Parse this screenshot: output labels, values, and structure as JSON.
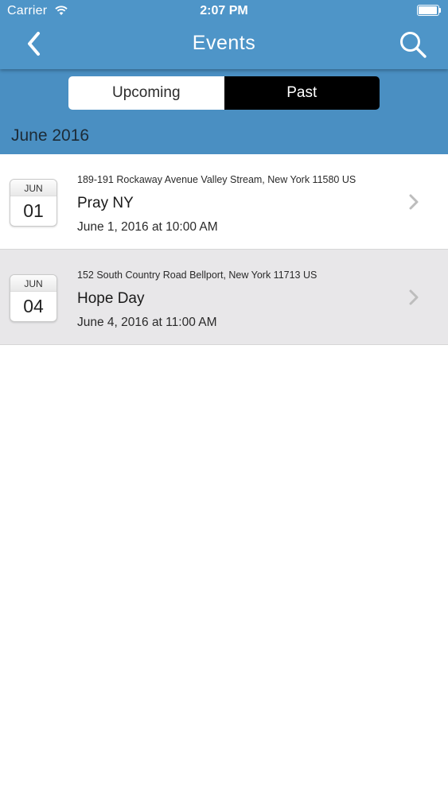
{
  "status_bar": {
    "carrier": "Carrier",
    "time": "2:07 PM"
  },
  "nav": {
    "title": "Events",
    "back_icon": "chevron-left-icon",
    "search_icon": "search-icon"
  },
  "segment": {
    "upcoming": "Upcoming",
    "past": "Past",
    "selected": "Past"
  },
  "section": {
    "title": "June 2016"
  },
  "events": [
    {
      "month": "JUN",
      "day": "01",
      "address": "189-191 Rockaway Avenue Valley Stream, New York 11580 US",
      "title": "Pray NY",
      "date": "June 1, 2016 at 10:00 AM"
    },
    {
      "month": "JUN",
      "day": "04",
      "address": "152 South Country Road Bellport, New York 11713 US",
      "title": "Hope Day",
      "date": "June 4, 2016 at 11:00 AM"
    }
  ],
  "colors": {
    "header": "#4a8fc2",
    "navbar": "#4e95c8",
    "selected_segment": "#000000",
    "alt_row": "#e8e7e9"
  }
}
